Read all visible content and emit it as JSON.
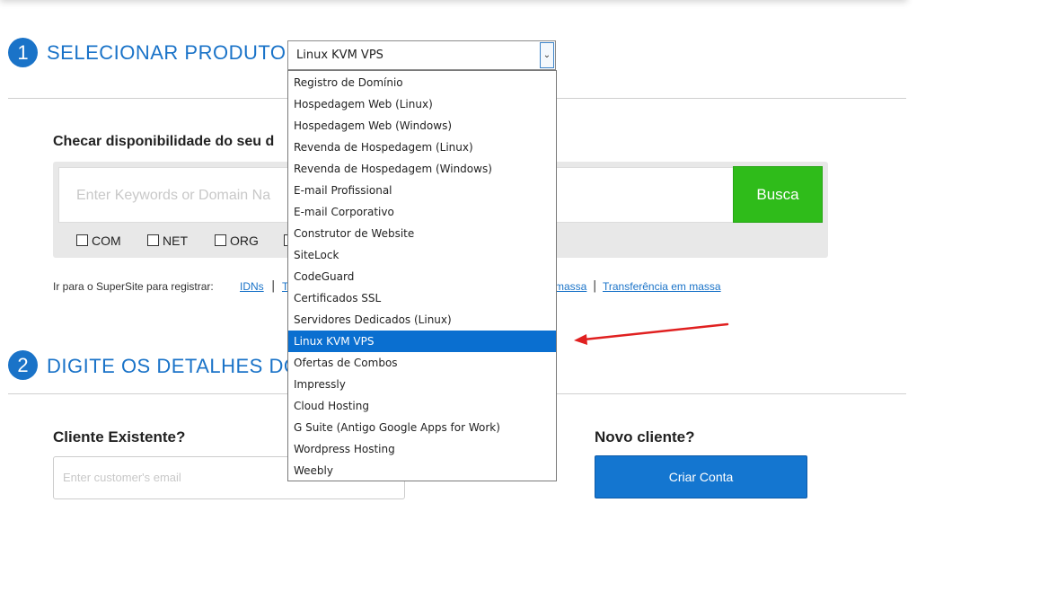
{
  "step1": {
    "number": "1",
    "title": "SELECIONAR PRODUTO:"
  },
  "product_select": {
    "value": "Linux KVM VPS",
    "options": [
      "Registro de Domínio",
      "Hospedagem Web (Linux)",
      "Hospedagem Web (Windows)",
      "Revenda de Hospedagem (Linux)",
      "Revenda de Hospedagem (Windows)",
      "E-mail Profissional",
      "E-mail Corporativo",
      "Construtor de Website",
      "SiteLock",
      "CodeGuard",
      "Certificados SSL",
      "Servidores Dedicados (Linux)",
      "Linux KVM VPS",
      "Ofertas de Combos",
      "Impressly",
      "Cloud Hosting",
      "G Suite (Antigo Google Apps for Work)",
      "Wordpress Hosting",
      "Weebly"
    ],
    "selected_index": 12
  },
  "domain_search": {
    "title": "Checar disponibilidade do seu d",
    "placeholder": "Enter Keywords or Domain Na",
    "button_label": "Busca",
    "tlds": [
      "COM",
      "NET",
      "ORG"
    ]
  },
  "supersite": {
    "prefix": "Ir para o SuperSite para registrar:",
    "links": [
      "IDNs",
      "T",
      "massa",
      "Transferência em massa"
    ]
  },
  "step2": {
    "number": "2",
    "title": "DIGITE OS DETALHES DO C"
  },
  "existing_customer": {
    "label": "Cliente Existente?",
    "placeholder": "Enter customer's email"
  },
  "new_customer": {
    "label": "Novo cliente?",
    "button_label": "Criar Conta"
  },
  "colors": {
    "accent": "#1a73c8",
    "search_button": "#2fbc1a",
    "selected_option": "#0a6fd0",
    "annotation_arrow": "#e02020"
  }
}
